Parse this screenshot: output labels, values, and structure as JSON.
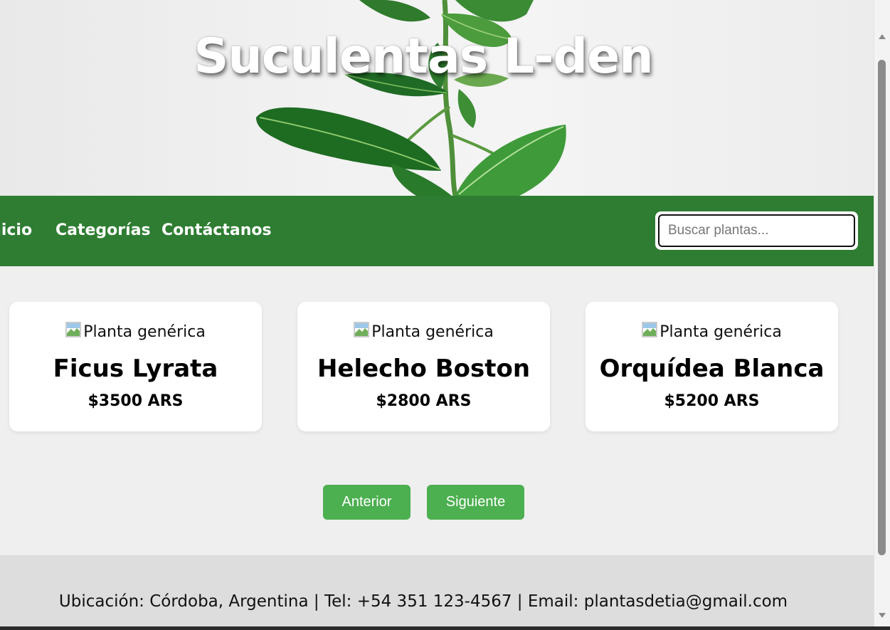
{
  "hero": {
    "title": "Suculentas L-den"
  },
  "nav": {
    "links": [
      {
        "label": "Inicio"
      },
      {
        "label": "Categorías"
      },
      {
        "label": "Contáctanos"
      }
    ],
    "search_placeholder": "Buscar plantas..."
  },
  "products": [
    {
      "image_alt": "Planta genérica",
      "name": "Ficus Lyrata",
      "price": "$3500 ARS"
    },
    {
      "image_alt": "Planta genérica",
      "name": "Helecho Boston",
      "price": "$2800 ARS"
    },
    {
      "image_alt": "Planta genérica",
      "name": "Orquídea Blanca",
      "price": "$5200 ARS"
    }
  ],
  "pagination": {
    "prev_label": "Anterior",
    "next_label": "Siguiente"
  },
  "footer": {
    "text": "Ubicación: Córdoba, Argentina | Tel: +54 351 123-4567 | Email: plantasdetia@gmail.com"
  },
  "colors": {
    "nav_bg": "#2e7d32",
    "button_bg": "#4caf50",
    "footer_bg": "#dddddd",
    "page_bg": "#efefef"
  }
}
